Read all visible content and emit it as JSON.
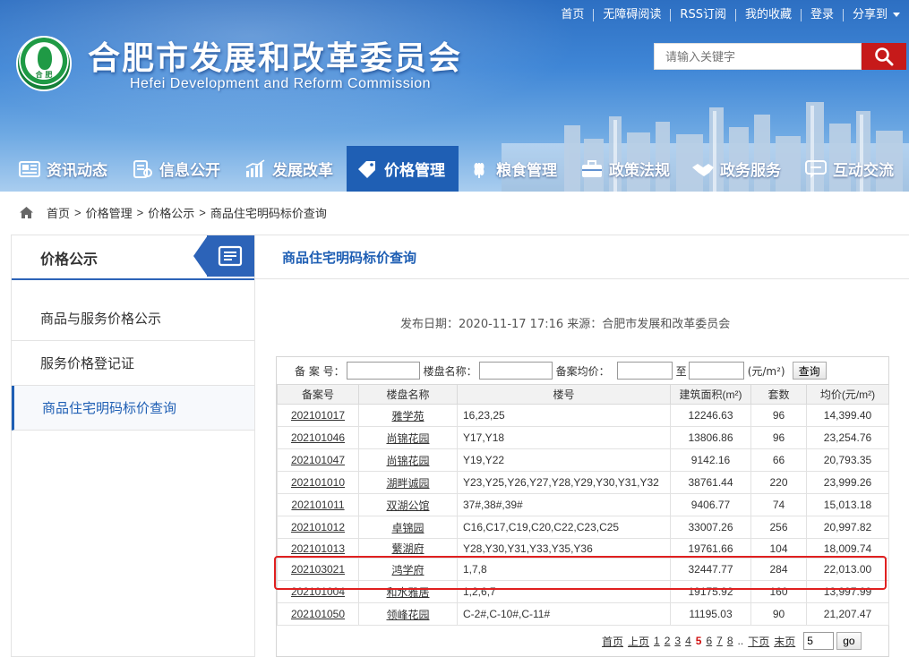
{
  "header": {
    "title": "合肥市发展和改革委员会",
    "subtitle": "Hefei Development and Reform Commission",
    "logo_text": "合 肥",
    "top_links": [
      "首页",
      "无障碍阅读",
      "RSS订阅",
      "我的收藏",
      "登录",
      "分享到"
    ],
    "search_placeholder": "请输入关键字",
    "colors": {
      "accent": "#1f5fb4",
      "search_button": "#c61a1a"
    }
  },
  "nav": {
    "items": [
      {
        "label": "资讯动态",
        "icon": "newspaper-icon"
      },
      {
        "label": "信息公开",
        "icon": "document-icon"
      },
      {
        "label": "发展改革",
        "icon": "bar-chart-icon"
      },
      {
        "label": "价格管理",
        "icon": "price-tag-icon",
        "active": true
      },
      {
        "label": "粮食管理",
        "icon": "wheat-icon"
      },
      {
        "label": "政策法规",
        "icon": "briefcase-icon"
      },
      {
        "label": "政务服务",
        "icon": "handshake-icon"
      },
      {
        "label": "互动交流",
        "icon": "chat-icon"
      }
    ]
  },
  "breadcrumb": [
    "首页",
    "价格管理",
    "价格公示",
    "商品住宅明码标价查询"
  ],
  "breadcrumb_sep": ">",
  "sidebar": {
    "title": "价格公示",
    "items": [
      {
        "label": "商品与服务价格公示"
      },
      {
        "label": "服务价格登记证"
      },
      {
        "label": "商品住宅明码标价查询",
        "active": true
      }
    ]
  },
  "content": {
    "title": "商品住宅明码标价查询",
    "publish_info": "发布日期：2020-11-17 17:16    来源：合肥市发展和改革委员会"
  },
  "filter": {
    "record_no_label": "备 案 号：",
    "name_label": "楼盘名称：",
    "price_label": "备案均价：",
    "to_label": "至",
    "unit_label": "(元/m²)",
    "query_button": "查询"
  },
  "table": {
    "headers": [
      "备案号",
      "楼盘名称",
      "楼号",
      "建筑面积(m²)",
      "套数",
      "均价(元/m²)"
    ],
    "rows": [
      [
        "202101017",
        "雅学苑",
        "16,23,25",
        "12246.63",
        "96",
        "14,399.40"
      ],
      [
        "202101046",
        "尚锦花园",
        "Y17,Y18",
        "13806.86",
        "96",
        "23,254.76"
      ],
      [
        "202101047",
        "尚锦花园",
        "Y19,Y22",
        "9142.16",
        "66",
        "20,793.35"
      ],
      [
        "202101010",
        "湖畔诚园",
        "Y23,Y25,Y26,Y27,Y28,Y29,Y30,Y31,Y32",
        "38761.44",
        "220",
        "23,999.26"
      ],
      [
        "202101011",
        "双湖公馆",
        "37#,38#,39#",
        "9406.77",
        "74",
        "15,013.18"
      ],
      [
        "202101012",
        "卓锦园",
        "C16,C17,C19,C20,C22,C23,C25",
        "33007.26",
        "256",
        "20,997.82"
      ],
      [
        "202101013",
        "蘩湖府",
        "Y28,Y30,Y31,Y33,Y35,Y36",
        "19761.66",
        "104",
        "18,009.74"
      ],
      [
        "202103021",
        "鸿学府",
        "1,7,8",
        "32447.77",
        "284",
        "22,013.00"
      ],
      [
        "202101004",
        "和水雅居",
        "1,2,6,7",
        "19175.92",
        "160",
        "13,997.99"
      ],
      [
        "202101050",
        "领峰花园",
        "C-2#,C-10#,C-11#",
        "11195.03",
        "90",
        "21,207.47"
      ]
    ],
    "highlighted_row_index": 7
  },
  "pager": {
    "first": "首页",
    "prev": "上页",
    "pages": [
      "1",
      "2",
      "3",
      "4",
      "5",
      "6",
      "7",
      "8"
    ],
    "current": "5",
    "ellipsis": "..",
    "next": "下页",
    "last": "末页",
    "input_value": "5",
    "go": "go"
  }
}
